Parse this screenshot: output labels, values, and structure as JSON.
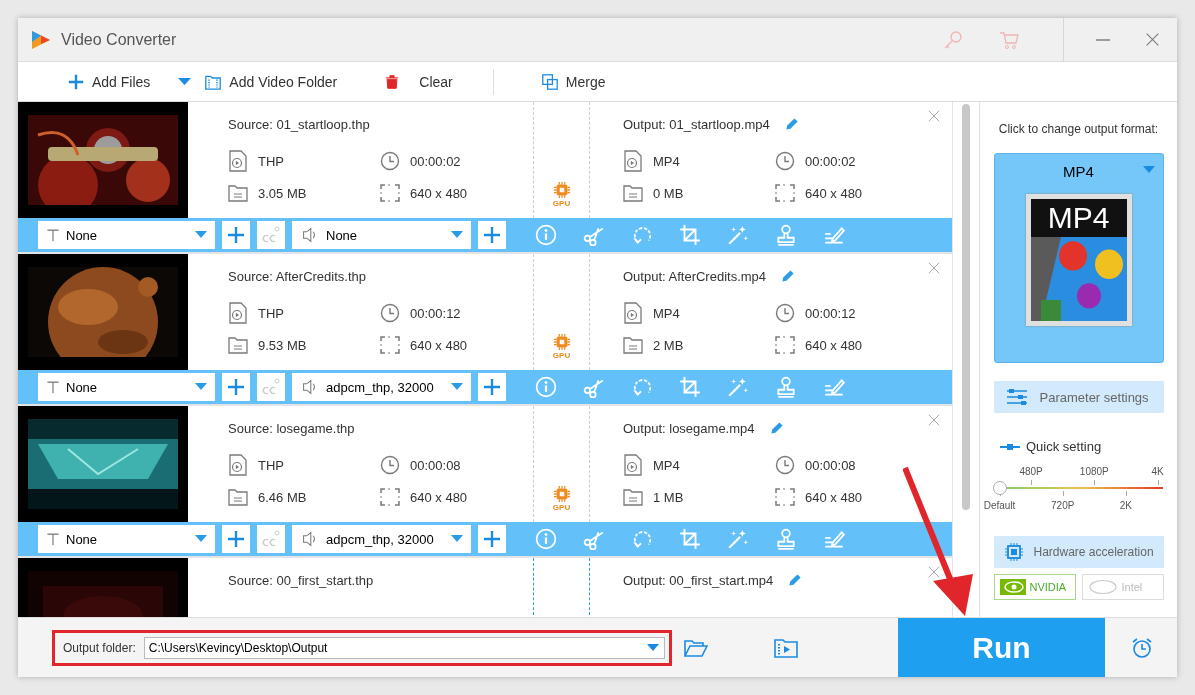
{
  "window": {
    "title": "Video Converter"
  },
  "toolbar": [
    {
      "kind": "add",
      "label": "Add Files"
    },
    {
      "kind": "dropdown"
    },
    {
      "kind": "folder",
      "label": "Add Video Folder"
    },
    {
      "kind": "clear",
      "label": "Clear"
    },
    {
      "kind": "merge",
      "label": "Merge"
    }
  ],
  "files": [
    {
      "selected": false,
      "source": "Source: 01_startloop.thp",
      "source_format": "THP",
      "source_duration": "00:00:02",
      "source_size": "3.05 MB",
      "source_resolution": "640 x 480",
      "gpu": "GPU",
      "output": "Output: 01_startloop.mp4",
      "output_format": "MP4",
      "output_duration": "00:00:02",
      "output_size": "0 MB",
      "output_resolution": "640 x 480",
      "subtitle": "None",
      "audio": "None"
    },
    {
      "selected": false,
      "source": "Source: AfterCredits.thp",
      "source_format": "THP",
      "source_duration": "00:00:12",
      "source_size": "9.53 MB",
      "source_resolution": "640 x 480",
      "gpu": "GPU",
      "output": "Output: AfterCredits.mp4",
      "output_format": "MP4",
      "output_duration": "00:00:12",
      "output_size": "2 MB",
      "output_resolution": "640 x 480",
      "subtitle": "None",
      "audio": "adpcm_thp, 32000"
    },
    {
      "selected": false,
      "source": "Source: losegame.thp",
      "source_format": "THP",
      "source_duration": "00:00:08",
      "source_size": "6.46 MB",
      "source_resolution": "640 x 480",
      "gpu": "GPU",
      "output": "Output: losegame.mp4",
      "output_format": "MP4",
      "output_duration": "00:00:08",
      "output_size": "1 MB",
      "output_resolution": "640 x 480",
      "subtitle": "None",
      "audio": "adpcm_thp, 32000"
    },
    {
      "selected": true,
      "source": "Source: 00_first_start.thp",
      "output": "Output: 00_first_start.mp4"
    }
  ],
  "format_panel": {
    "prompt": "Click to change output format:",
    "format": "MP4",
    "icon_label": "MP4"
  },
  "parameter_settings": "Parameter settings",
  "quick_setting": {
    "label": "Quick setting",
    "ticks": [
      "Default",
      "480P",
      "720P",
      "1080P",
      "2K",
      "4K"
    ],
    "level": 0
  },
  "hardware": {
    "label": "Hardware acceleration",
    "options": [
      {
        "kind": "nvidia",
        "label": "NVIDIA",
        "disabled": false
      },
      {
        "kind": "intel",
        "label": "Intel",
        "disabled": true
      }
    ]
  },
  "output_folder": {
    "label": "Output folder:",
    "value": "C:\\Users\\Kevincy\\Desktop\\Output"
  },
  "run": "Run"
}
